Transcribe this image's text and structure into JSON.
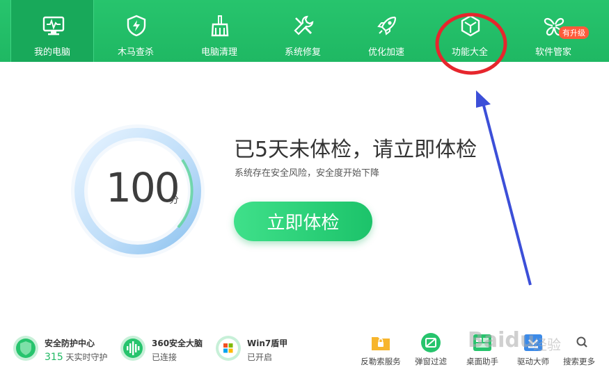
{
  "nav": {
    "items": [
      {
        "label": "我的电脑",
        "icon": "monitor-icon"
      },
      {
        "label": "木马查杀",
        "icon": "shield-icon"
      },
      {
        "label": "电脑清理",
        "icon": "broom-icon"
      },
      {
        "label": "系统修复",
        "icon": "wrench-icon"
      },
      {
        "label": "优化加速",
        "icon": "rocket-icon"
      },
      {
        "label": "功能大全",
        "icon": "cube-icon"
      },
      {
        "label": "软件管家",
        "icon": "clover-icon"
      }
    ],
    "upgrade_badge": "有升级"
  },
  "score": {
    "value": "100",
    "unit": "分"
  },
  "main": {
    "headline": "已5天未体检，请立即体检",
    "subline": "系统存在安全风险，安全度开始下降",
    "cta_label": "立即体检"
  },
  "status": [
    {
      "title": "安全防护中心",
      "days": "315",
      "subtitle": " 天实时守护"
    },
    {
      "title": "360安全大脑",
      "subtitle": "已连接"
    },
    {
      "title": "Win7盾甲",
      "subtitle": "已开启"
    }
  ],
  "tools": [
    {
      "label": "反勒索服务",
      "icon": "folder-lock-icon"
    },
    {
      "label": "弹窗过滤",
      "icon": "popup-filter-icon"
    },
    {
      "label": "桌面助手",
      "icon": "desktop-assistant-icon"
    },
    {
      "label": "驱动大师",
      "icon": "driver-icon"
    },
    {
      "label": "搜索更多",
      "icon": "search-icon"
    }
  ],
  "watermark": {
    "text": "Baidu",
    "text2": "经验"
  },
  "colors": {
    "brand_green": "#1fb863",
    "badge_red": "#ff5b3b",
    "annotation_red": "#e6262d",
    "arrow_blue": "#3c4fd8"
  }
}
